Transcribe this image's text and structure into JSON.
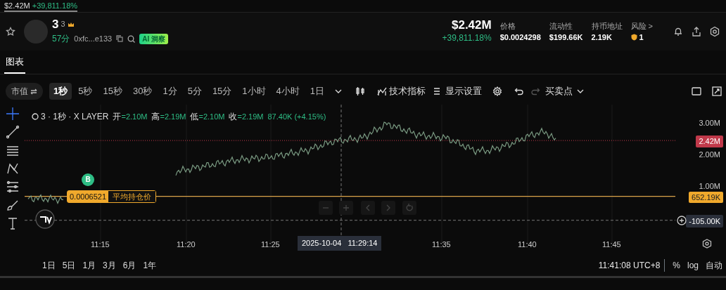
{
  "ticker": [
    {
      "price": "$2.42M",
      "change": "+39,811.18%",
      "selected": true
    }
  ],
  "token": {
    "symbol": "3",
    "name": "3",
    "age": "57分",
    "address": "0xfc...e133",
    "ai_badge": "AI 洞察"
  },
  "market_cap": {
    "value": "$2.42M",
    "change": "+39,811.18%"
  },
  "stats": [
    {
      "label": "价格",
      "value": "$0.0024298"
    },
    {
      "label": "流动性",
      "value": "$199.66K"
    },
    {
      "label": "持币地址",
      "value": "2.19K"
    }
  ],
  "risk": {
    "label": "风险 >",
    "value": "1"
  },
  "tabs": [
    {
      "label": "图表",
      "selected": true
    }
  ],
  "toolbar": {
    "mode": "市值",
    "intervals": [
      {
        "label": "1秒",
        "selected": true
      },
      {
        "label": "5秒",
        "selected": false
      },
      {
        "label": "15秒",
        "selected": false
      },
      {
        "label": "30秒",
        "selected": false
      },
      {
        "label": "1分",
        "selected": false
      },
      {
        "label": "5分",
        "selected": false
      },
      {
        "label": "15分",
        "selected": false
      },
      {
        "label": "1小时",
        "selected": false
      },
      {
        "label": "4小时",
        "selected": false
      },
      {
        "label": "1日",
        "selected": false
      }
    ],
    "indicators": "技术指标",
    "display": "显示设置",
    "trades": "买卖点"
  },
  "chart": {
    "legend": {
      "title": "3 · 1秒 · X LAYER",
      "ohlc": [
        {
          "label": "开",
          "value": "=2.10M"
        },
        {
          "label": "高",
          "value": "=2.19M"
        },
        {
          "label": "低",
          "value": "=2.10M"
        },
        {
          "label": "收",
          "value": "=2.19M"
        }
      ],
      "change": "87.40K (+4.15%)"
    },
    "price_ticks": [
      "3.00M",
      "2.00M",
      "1.00M"
    ],
    "current_price": "2.42M",
    "avg_cost": {
      "value": "0.0006521",
      "label": "平均持仓价",
      "axis": "652.19K"
    },
    "cursor_price": "-105.00K",
    "marker": "B",
    "time_ticks": [
      "11:15",
      "11:20",
      "11:25",
      "11:35",
      "11:40",
      "11:45"
    ],
    "cursor_time": "2025-10-04   11:29:14"
  },
  "ranges": [
    "1日",
    "5日",
    "1月",
    "3月",
    "6月",
    "1年"
  ],
  "clock": "11:41:08 UTC+8",
  "scales": [
    "%",
    "log",
    "自动"
  ]
}
